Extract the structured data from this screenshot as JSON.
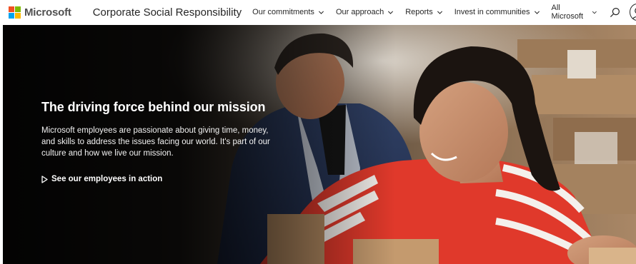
{
  "header": {
    "brand": "Microsoft",
    "site_title": "Corporate Social Responsibility",
    "nav": [
      {
        "label": "Our commitments"
      },
      {
        "label": "Our approach"
      },
      {
        "label": "Reports"
      },
      {
        "label": "Invest in communities"
      }
    ],
    "all_microsoft": "All Microsoft",
    "search_icon": "search-icon",
    "account_icon": "account-icon"
  },
  "hero": {
    "title": "The driving force behind our mission",
    "description": "Microsoft employees are passionate about giving time, money, and skills to address the issues facing our world. It's part of our culture and how we live our mission.",
    "cta_label": "See our employees in action",
    "cta_icon": "play-icon"
  },
  "colors": {
    "logo_red": "#f25022",
    "logo_green": "#7fba00",
    "logo_blue": "#00a4ef",
    "logo_yellow": "#ffb900",
    "shirt_red": "#e0392b"
  }
}
